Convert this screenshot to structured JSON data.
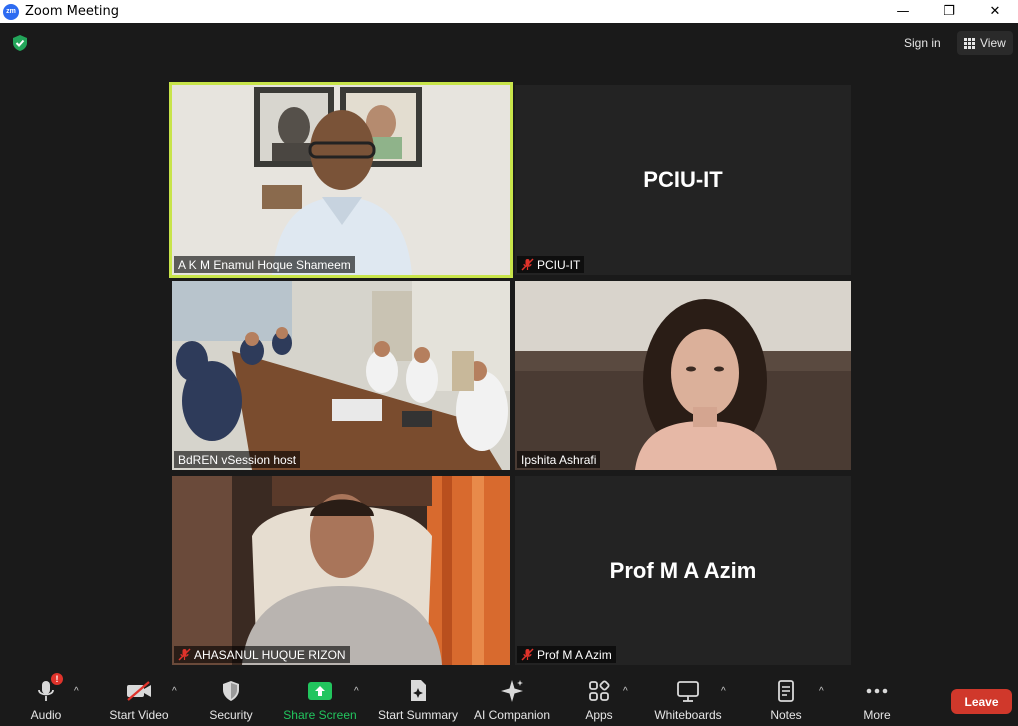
{
  "window": {
    "title": "Zoom Meeting",
    "app_icon_text": "zm",
    "minimize_glyph": "—",
    "maximize_glyph": "❐",
    "close_glyph": "✕"
  },
  "topbar": {
    "signin_label": "Sign in",
    "view_label": "View"
  },
  "tiles": [
    {
      "name": "A K M Enamul Hoque Shameem",
      "muted": false,
      "video": true,
      "active": true
    },
    {
      "name": "PCIU-IT",
      "muted": true,
      "video": false,
      "display_name": "PCIU-IT"
    },
    {
      "name": "BdREN vSession host",
      "muted": false,
      "video": true
    },
    {
      "name": "Ipshita Ashrafi",
      "muted": false,
      "video": true
    },
    {
      "name": "AHASANUL HUQUE RIZON",
      "muted": true,
      "video": true
    },
    {
      "name": "Prof M A Azim",
      "muted": true,
      "video": false,
      "display_name": "Prof M A Azim"
    }
  ],
  "toolbar": {
    "audio": "Audio",
    "audio_badge": "!",
    "start_video": "Start Video",
    "security": "Security",
    "share_screen": "Share Screen",
    "start_summary": "Start Summary",
    "ai_companion": "AI Companion",
    "apps": "Apps",
    "whiteboards": "Whiteboards",
    "notes": "Notes",
    "more": "More",
    "leave": "Leave",
    "caret_glyph": "^"
  },
  "colors": {
    "active_speaker_border": "#c8e44a",
    "leave_button": "#d0382b",
    "share_screen": "#22c55e",
    "background": "#1a1a1a"
  }
}
